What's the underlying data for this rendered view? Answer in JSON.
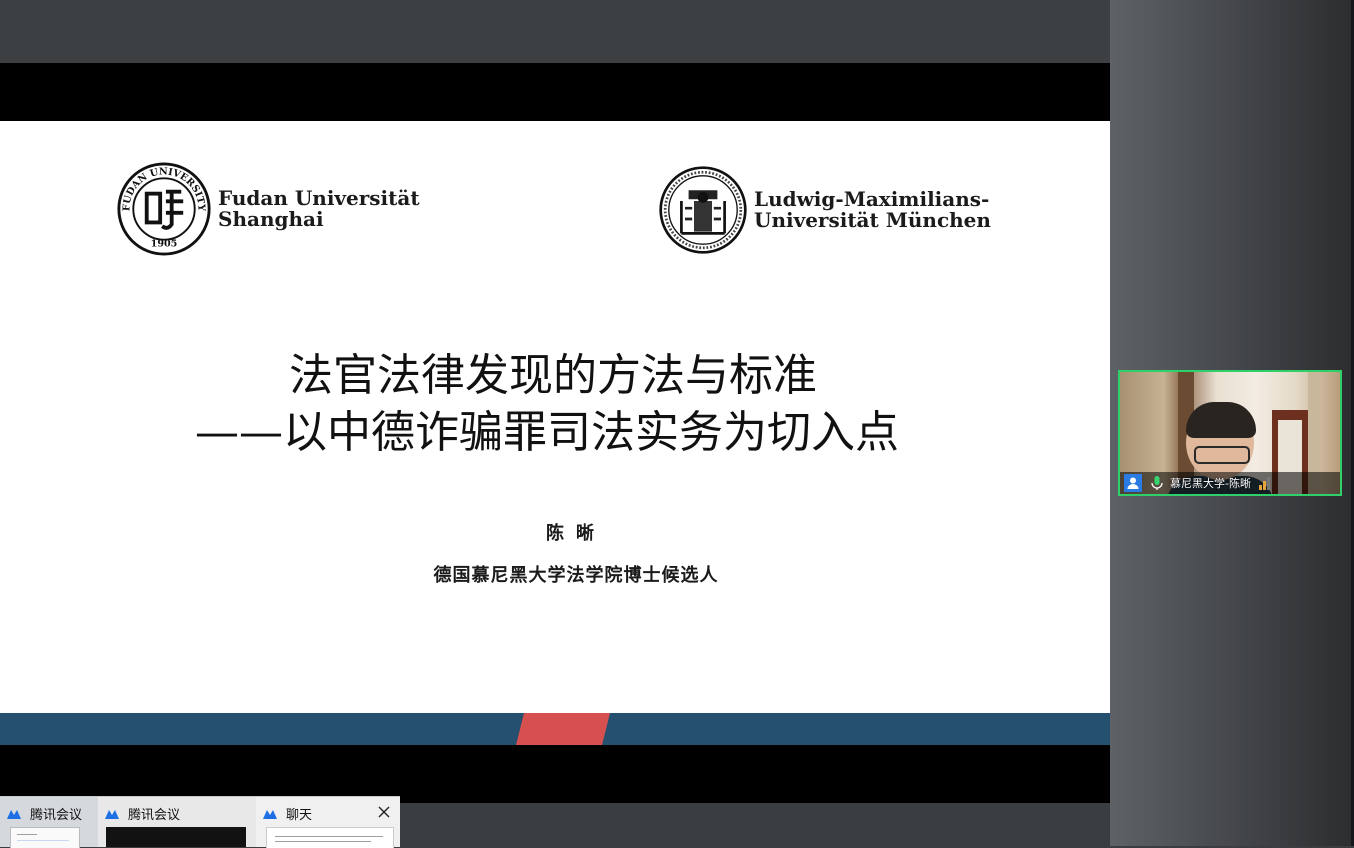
{
  "slide": {
    "fudan_name_line1": "Fudan Universität",
    "fudan_name_line2": "Shanghai",
    "fudan_seal_text": "FUDAN UNIVERSITY 1905",
    "lmu_name_line1": "Ludwig-Maximilians-",
    "lmu_name_line2": "Universität München",
    "title_line1": "法官法律发现的方法与标准",
    "title_line2": "——以中德诈骗罪司法实务为切入点",
    "author": "陈晰",
    "affiliation": "德国慕尼黑大学法学院博士候选人",
    "colors": {
      "band": "#26506f",
      "accent": "#d6504f"
    }
  },
  "participant": {
    "name": "慕尼黑大学-陈晰",
    "icons": [
      "user-icon",
      "microphone-icon",
      "signal-icon"
    ],
    "active_border_color": "#2fcf6a"
  },
  "taskbar": {
    "tabs": [
      {
        "label": "腾讯会议",
        "icon": "tencent-meeting-icon"
      },
      {
        "label": "腾讯会议",
        "icon": "tencent-meeting-icon"
      },
      {
        "label": "聊天",
        "icon": "tencent-meeting-icon"
      }
    ],
    "close_icon": "close-icon"
  }
}
